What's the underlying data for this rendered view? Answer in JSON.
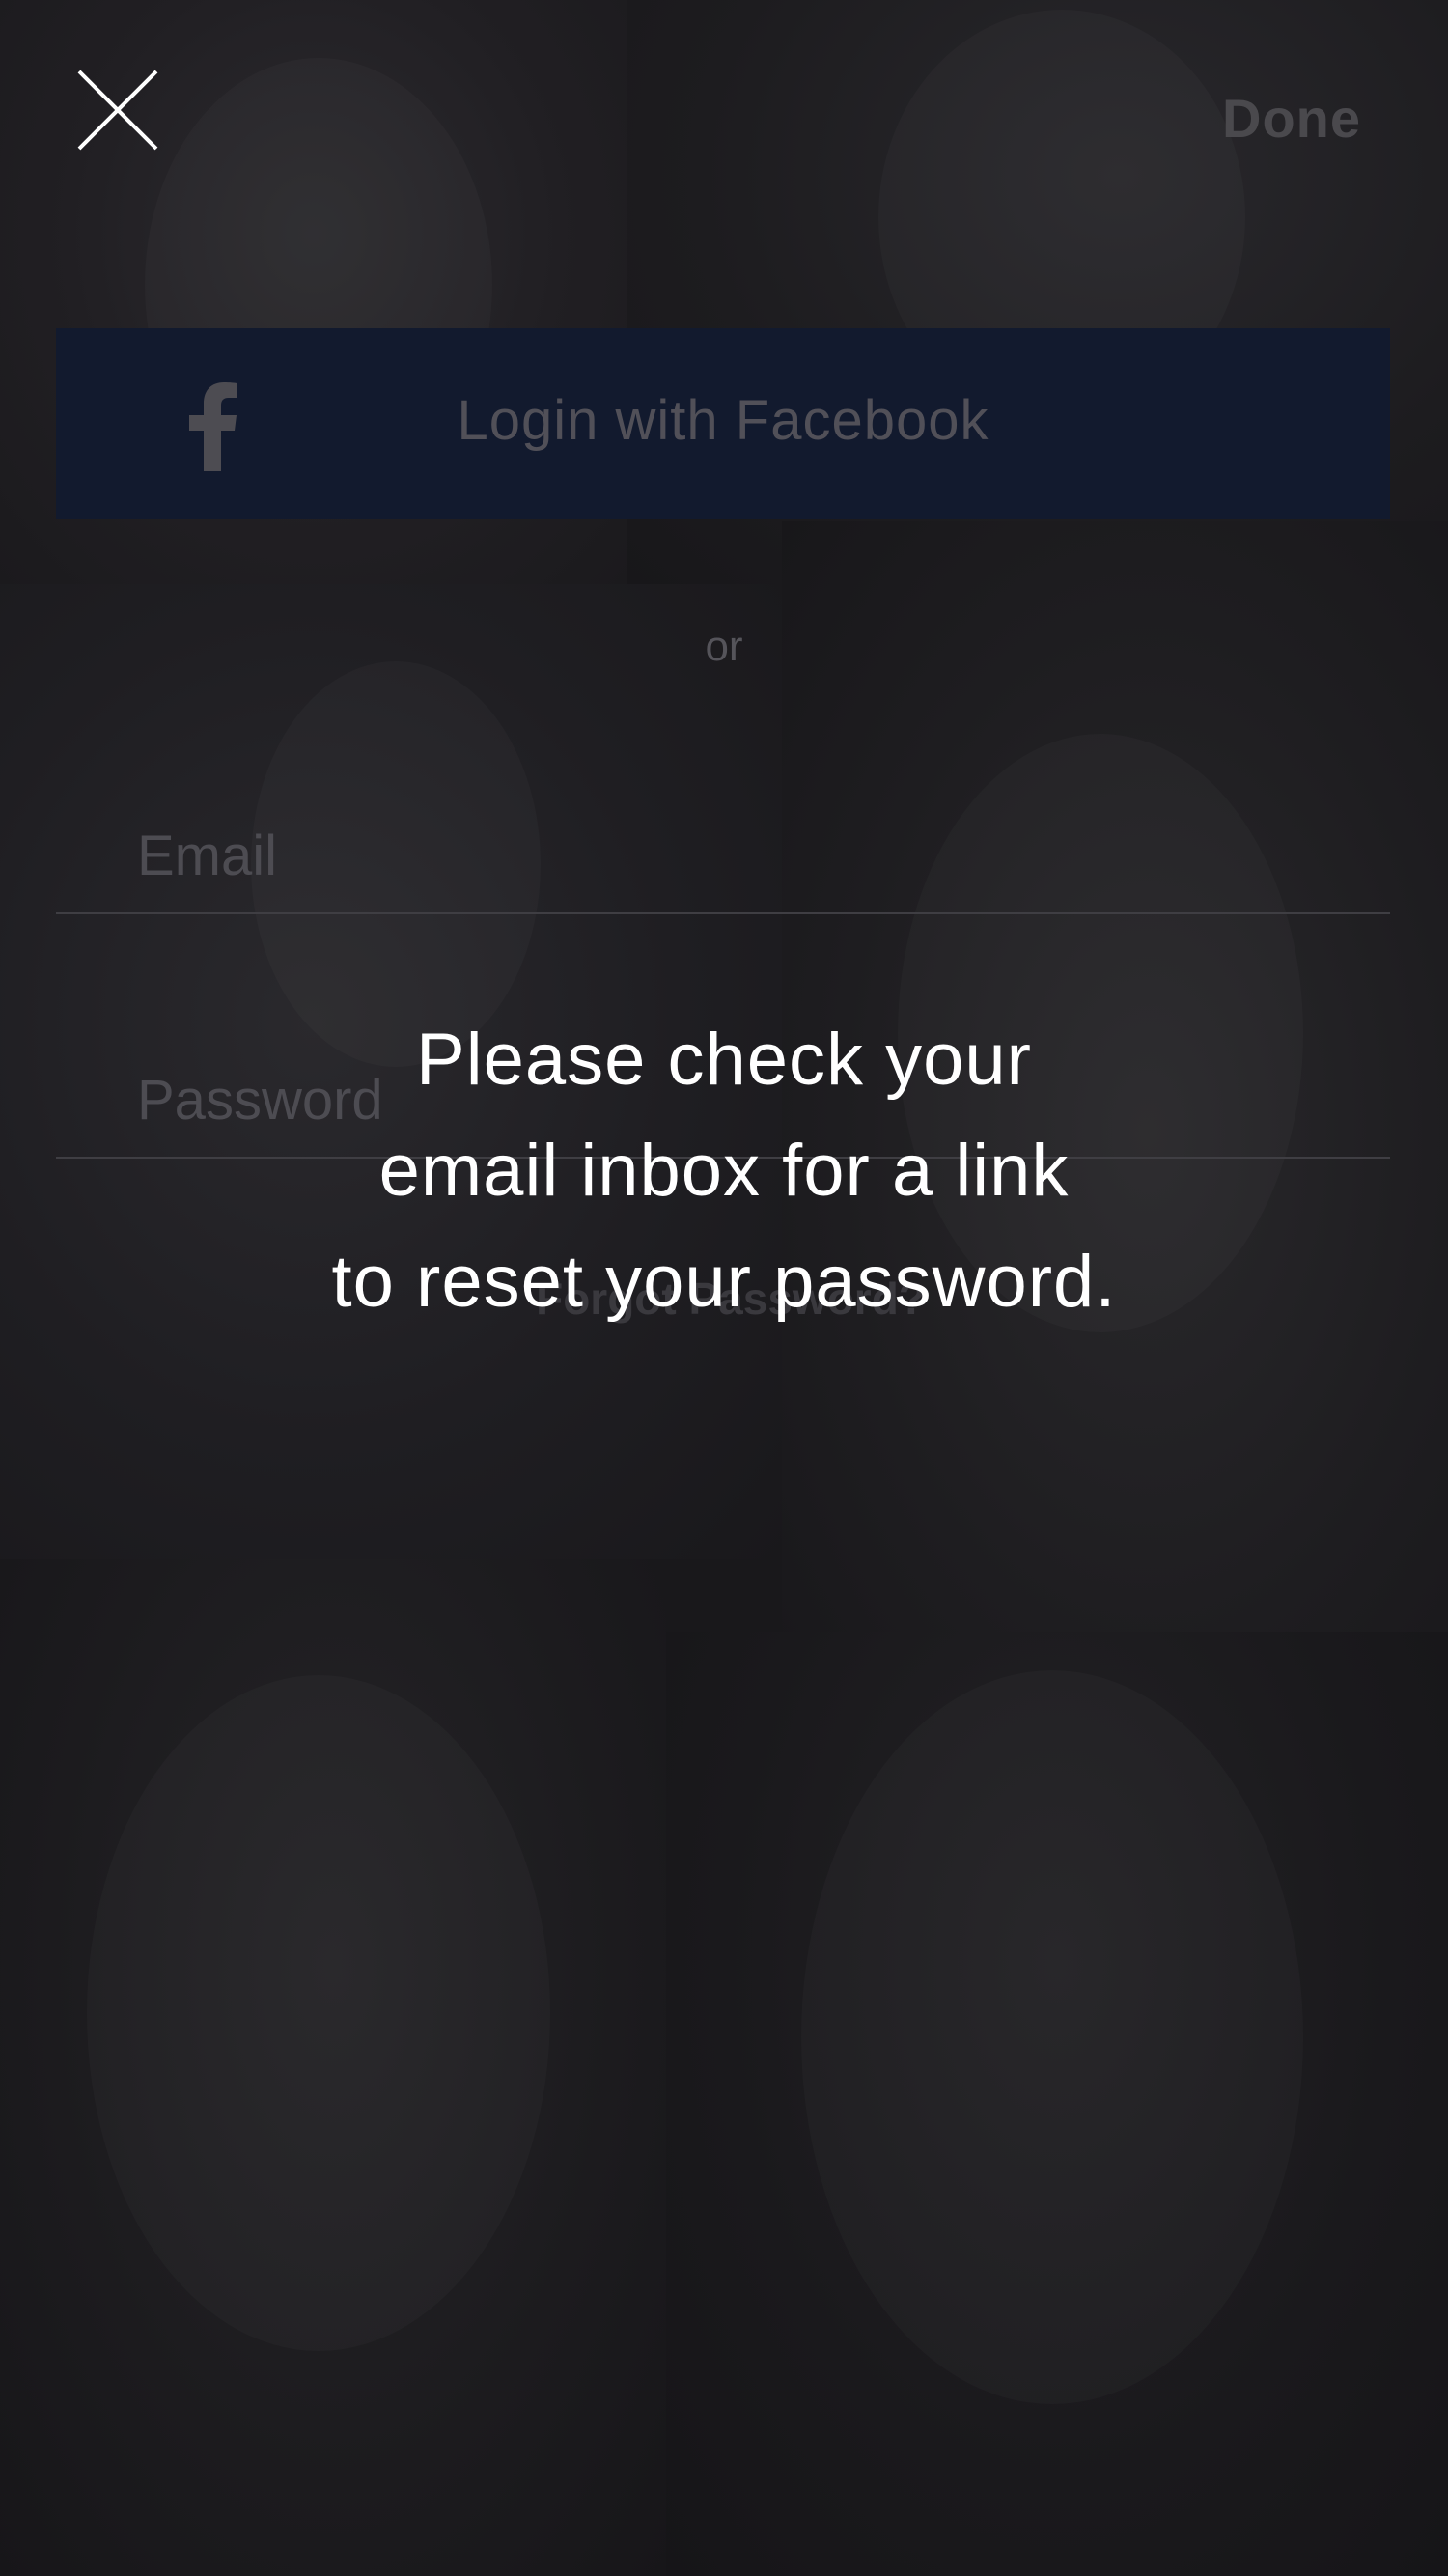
{
  "top_bar": {
    "close_icon": "close-icon",
    "done_label": "Done"
  },
  "facebook": {
    "icon": "facebook-icon",
    "label": "Login with Facebook",
    "color": "#121a2e"
  },
  "divider": {
    "or_label": "or"
  },
  "form": {
    "email_placeholder": "Email",
    "email_value": "",
    "password_placeholder": "Password",
    "password_value": "",
    "forgot_label": "Forgot Password?"
  },
  "message": {
    "lines": [
      "Please check your",
      "email inbox for a link",
      "to reset your password."
    ]
  }
}
